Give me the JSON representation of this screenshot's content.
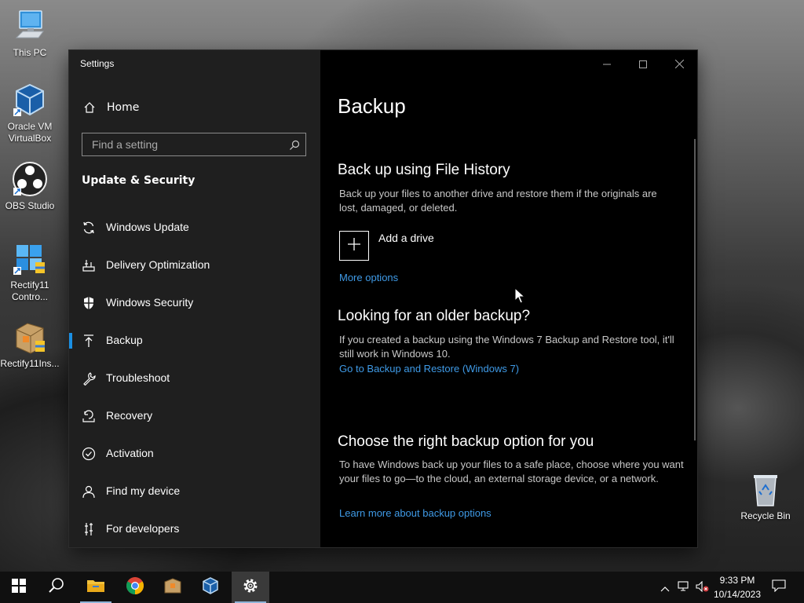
{
  "desktop": {
    "icons": [
      {
        "label": "This PC",
        "icon": "computer-icon"
      },
      {
        "label": "Oracle VM VirtualBox",
        "icon": "virtualbox-icon"
      },
      {
        "label": "OBS Studio",
        "icon": "obs-icon"
      },
      {
        "label": "Rectify11 Contro...",
        "icon": "rectify11-control-icon"
      },
      {
        "label": "Rectify11Ins...",
        "icon": "installer-package-icon"
      },
      {
        "label": "Recycle Bin",
        "icon": "recycle-bin-icon"
      }
    ]
  },
  "window": {
    "title": "Settings",
    "controls": {
      "minimize": "minimize-icon",
      "maximize": "maximize-icon",
      "close": "close-icon"
    }
  },
  "sidebar": {
    "home_label": "Home",
    "search_placeholder": "Find a setting",
    "section_title": "Update & Security",
    "items": [
      {
        "label": "Windows Update",
        "icon": "sync-icon"
      },
      {
        "label": "Delivery Optimization",
        "icon": "delivery-optimization-icon"
      },
      {
        "label": "Windows Security",
        "icon": "shield-icon"
      },
      {
        "label": "Backup",
        "icon": "backup-arrow-icon",
        "selected": true
      },
      {
        "label": "Troubleshoot",
        "icon": "wrench-icon"
      },
      {
        "label": "Recovery",
        "icon": "recovery-icon"
      },
      {
        "label": "Activation",
        "icon": "check-circle-icon"
      },
      {
        "label": "Find my device",
        "icon": "person-locate-icon"
      },
      {
        "label": "For developers",
        "icon": "developer-tools-icon"
      }
    ]
  },
  "main": {
    "page_title": "Backup",
    "file_history": {
      "heading": "Back up using File History",
      "description": "Back up your files to another drive and restore them if the originals are lost, damaged, or deleted.",
      "add_drive_label": "Add a drive",
      "more_options_link": "More options"
    },
    "older_backup": {
      "heading": "Looking for an older backup?",
      "description": "If you created a backup using the Windows 7 Backup and Restore tool, it'll still work in Windows 10.",
      "link": "Go to Backup and Restore (Windows 7)"
    },
    "right_option": {
      "heading": "Choose the right backup option for you",
      "description": "To have Windows back up your files to a safe place, choose where you want your files to go—to the cloud, an external storage device, or a network.",
      "link": "Learn more about backup options"
    }
  },
  "taskbar": {
    "apps": [
      {
        "name": "start",
        "icon": "windows-start-icon"
      },
      {
        "name": "search",
        "icon": "search-icon"
      },
      {
        "name": "file-explorer",
        "icon": "folder-icon"
      },
      {
        "name": "chrome",
        "icon": "chrome-icon"
      },
      {
        "name": "package",
        "icon": "package-icon"
      },
      {
        "name": "virtualbox",
        "icon": "virtualbox-icon"
      },
      {
        "name": "settings",
        "icon": "gear-icon",
        "active": true
      }
    ],
    "tray": {
      "time": "9:33 PM",
      "date": "10/14/2023"
    }
  },
  "colors": {
    "accent": "#1a8fe3",
    "link": "#3f9ae6",
    "sidebar_bg": "#1f1f1f",
    "content_bg": "#000000"
  }
}
